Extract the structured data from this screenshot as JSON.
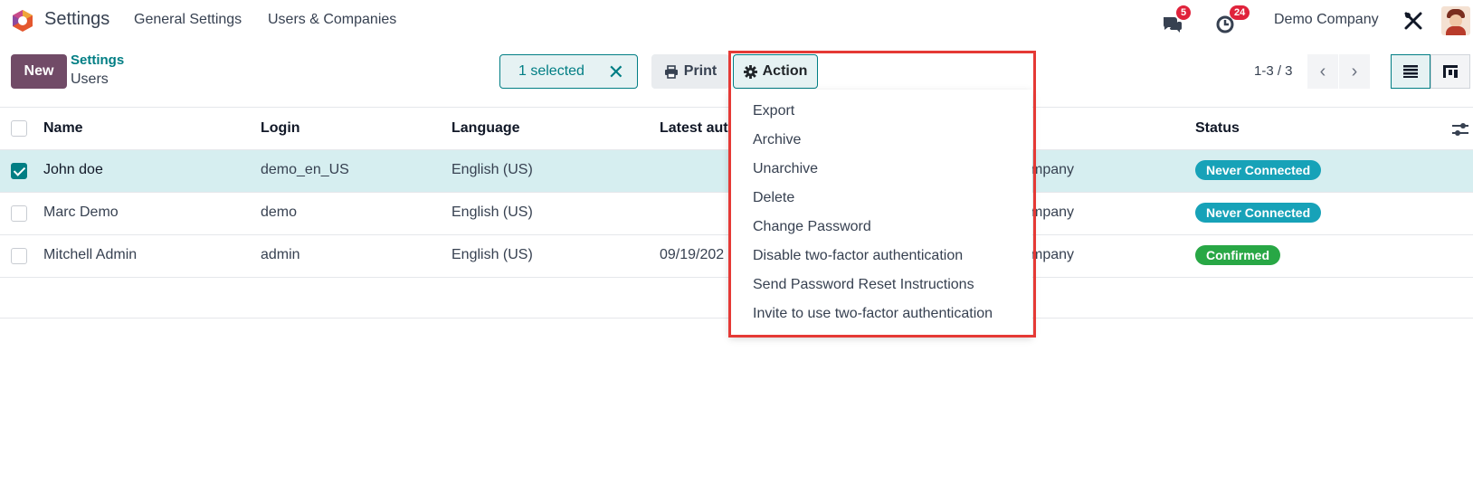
{
  "navbar": {
    "app_title": "Settings",
    "menu": [
      "General Settings",
      "Users & Companies"
    ],
    "messages_count": "5",
    "activities_count": "24",
    "company": "Demo Company"
  },
  "control": {
    "new_label": "New",
    "breadcrumb_parent": "Settings",
    "breadcrumb_current": "Users",
    "selected_label": "1 selected",
    "print_label": "Print",
    "action_label": "Action",
    "pager": "1-3 / 3"
  },
  "table": {
    "columns": [
      "Name",
      "Login",
      "Language",
      "Latest aut",
      "Status"
    ],
    "rows": [
      {
        "name": "John doe",
        "login": "demo_en_US",
        "language": "English (US)",
        "latest": "",
        "company": "mpany",
        "status": "Never Connected",
        "selected": true
      },
      {
        "name": "Marc Demo",
        "login": "demo",
        "language": "English (US)",
        "latest": "",
        "company": "mpany",
        "status": "Never Connected",
        "selected": false
      },
      {
        "name": "Mitchell Admin",
        "login": "admin",
        "language": "English (US)",
        "latest": "09/19/202",
        "company": "mpany",
        "status": "Confirmed",
        "selected": false
      }
    ]
  },
  "dropdown": {
    "items": [
      "Export",
      "Archive",
      "Unarchive",
      "Delete",
      "Change Password",
      "Disable two-factor authentication",
      "Send Password Reset Instructions",
      "Invite to use two-factor authentication"
    ]
  },
  "colors": {
    "brand": "#714b67",
    "accent": "#017e84",
    "highlight": "#e53935",
    "status_info": "#17a2b8",
    "status_ok": "#28a745"
  }
}
